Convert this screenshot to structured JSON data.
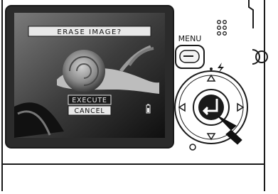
{
  "lcd": {
    "title": "ERASE IMAGE?",
    "options": {
      "execute": "EXECUTE",
      "cancel": "CANCEL"
    },
    "selected": "cancel"
  },
  "camera": {
    "menu_label": "MENU",
    "controller_icons": [
      "up-triangle-icon",
      "down-triangle-icon",
      "left-triangle-icon",
      "right-triangle-icon",
      "enter-arrow-icon"
    ],
    "flash_symbol": "flash-icon"
  },
  "colors": {
    "outline": "#1a1a1a",
    "lcd_bezel": "#222222",
    "highlight": "#f2f2f2",
    "body": "#ffffff"
  }
}
